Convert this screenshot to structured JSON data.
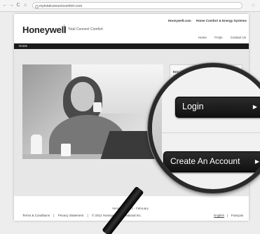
{
  "browser": {
    "back": "←",
    "forward": "→",
    "reload": "C",
    "home": "⌂",
    "url": "mytotalconnectcomfort.com",
    "star": "☆"
  },
  "header": {
    "logo": "Honeywell",
    "app_name": "Total Connect Comfort",
    "top_links": [
      "Honeywell.com",
      "Home Comfort & Energy Systems"
    ],
    "sub_nav": [
      "Home",
      "FAQs",
      "Contact Us"
    ]
  },
  "menubar": {
    "home": "Home"
  },
  "login": {
    "email_label": "Email Address",
    "login_button": "Login",
    "create_account_button": "Create An Account",
    "arrow": "▶"
  },
  "footer": {
    "version": "Version: 1.2.22 - February",
    "links": [
      "Terms & Conditions",
      "|",
      "Privacy Statement",
      "|",
      "© 2012 Honeywell International Inc."
    ],
    "lang_english": "English",
    "lang_sep": "|",
    "lang_french": "Français"
  },
  "colors": {
    "menubar": "#1a1a1a",
    "button": "#1b1b1b",
    "content_bg": "#e7e7e7"
  }
}
